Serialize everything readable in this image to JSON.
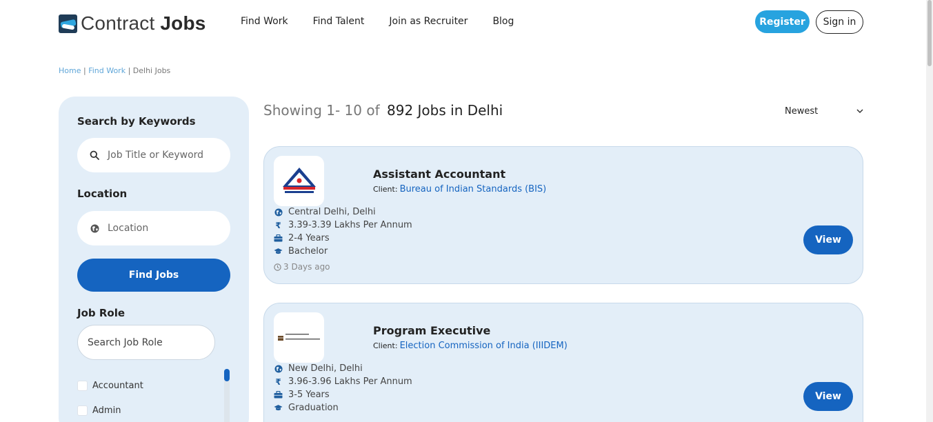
{
  "header": {
    "logo_text_light": "Contract",
    "logo_text_bold": "Jobs",
    "nav": [
      "Find Work",
      "Find Talent",
      "Join as Recruiter",
      "Blog"
    ],
    "register_label": "Register",
    "signin_label": "Sign in"
  },
  "breadcrumb": {
    "home": "Home",
    "sep1": " | ",
    "find_work": "Find Work",
    "sep2": " | ",
    "current": "Delhi Jobs"
  },
  "sidebar": {
    "keywords_heading": "Search by Keywords",
    "keywords_placeholder": "Job Title or Keyword",
    "location_heading": "Location",
    "location_placeholder": "Location",
    "find_button": "Find Jobs",
    "role_heading": "Job Role",
    "role_placeholder": "Search Job Role",
    "roles": [
      "Accountant",
      "Admin"
    ]
  },
  "results": {
    "showing_prefix": "Showing 1- 10 of",
    "showing_count": "892 Jobs in Delhi",
    "sort_selected": "Newest"
  },
  "jobs": [
    {
      "title": "Assistant Accountant",
      "client_label": "Client:",
      "client": "Bureau of Indian Standards (BIS)",
      "location": "Central Delhi, Delhi",
      "salary": "3.39-3.39 Lakhs Per Annum",
      "experience": "2-4 Years",
      "education": "Bachelor",
      "posted": "3 Days ago",
      "view_label": "View"
    },
    {
      "title": "Program Executive",
      "client_label": "Client:",
      "client": "Election Commission of India (IIIDEM)",
      "location": "New Delhi, Delhi",
      "salary": "3.96-3.96 Lakhs Per Annum",
      "experience": "3-5 Years",
      "education": "Graduation",
      "view_label": "View"
    }
  ],
  "icons": {
    "location": "globe-icon",
    "salary": "rupee-icon",
    "experience": "briefcase-icon",
    "education": "graduation-cap-icon",
    "posted": "clock-icon"
  },
  "colors": {
    "primary": "#1564c0",
    "accent": "#27a3df",
    "panel": "#e3eef8"
  }
}
